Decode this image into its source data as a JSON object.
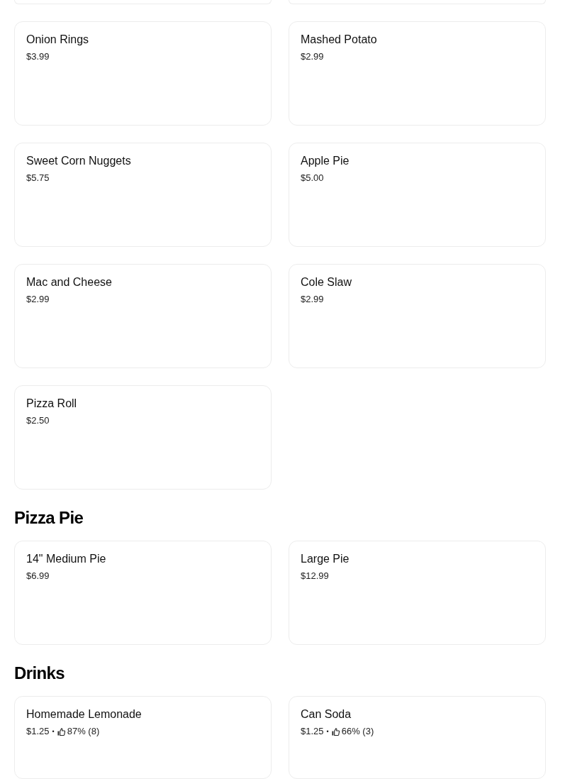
{
  "sections": [
    {
      "continued_from_above": true,
      "items": [
        {
          "name": "Onion Rings",
          "price": "$3.99"
        },
        {
          "name": "Mashed Potato",
          "price": "$2.99"
        },
        {
          "name": "Sweet Corn Nuggets",
          "price": "$5.75"
        },
        {
          "name": "Apple Pie",
          "price": "$5.00"
        },
        {
          "name": "Mac and Cheese",
          "price": "$2.99"
        },
        {
          "name": "Cole Slaw",
          "price": "$2.99"
        },
        {
          "name": "Pizza Roll",
          "price": "$2.50"
        }
      ]
    },
    {
      "heading": "Pizza Pie",
      "items": [
        {
          "name": "14\" Medium Pie",
          "price": "$6.99"
        },
        {
          "name": "Large Pie",
          "price": "$12.99"
        }
      ]
    },
    {
      "heading": "Drinks",
      "items": [
        {
          "name": "Homemade Lemonade",
          "price": "$1.25",
          "separator": "•",
          "rating": "87% (8)"
        },
        {
          "name": "Can Soda",
          "price": "$1.25",
          "separator": "•",
          "rating": "66% (3)"
        }
      ]
    }
  ]
}
